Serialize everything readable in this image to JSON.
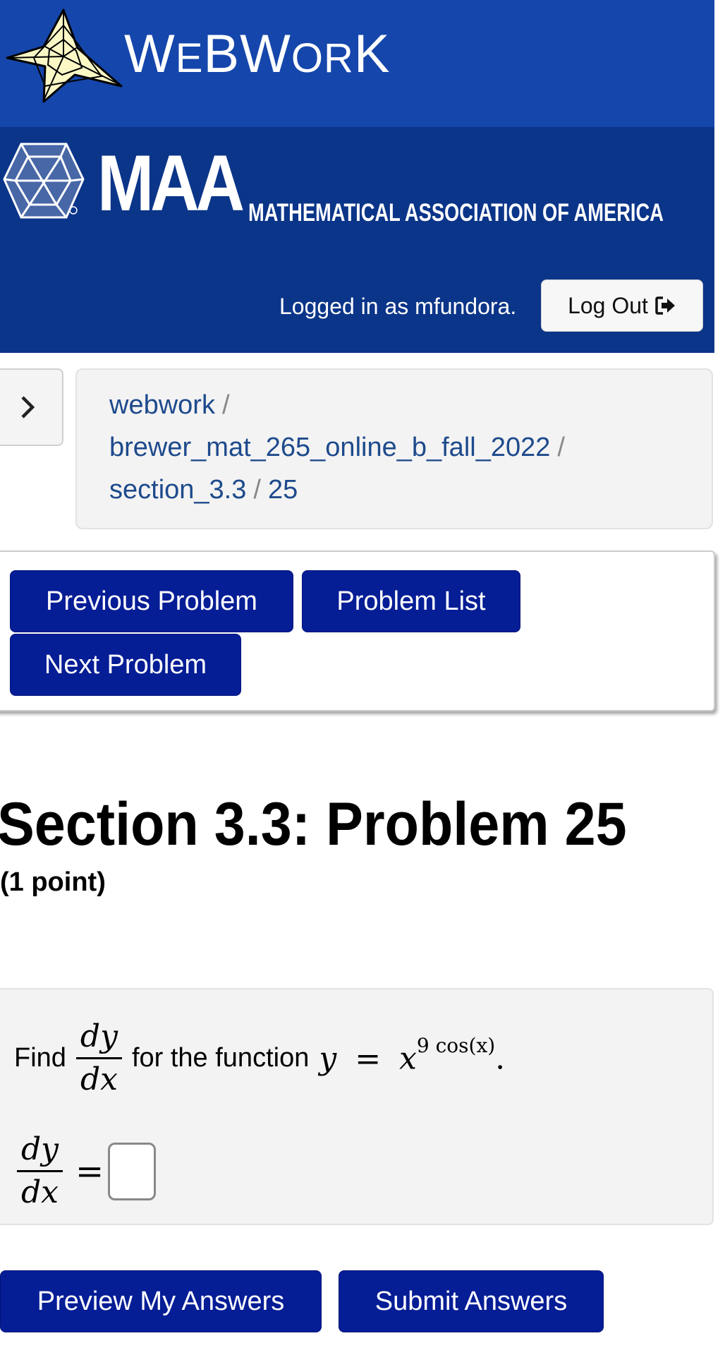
{
  "header": {
    "brand_w": "W",
    "brand_e": "E",
    "brand_bw": "BW",
    "brand_o": "O",
    "brand_r": "R",
    "brand_k": "K",
    "logo_icon": "webwork-spiderweb-star-icon"
  },
  "institution": {
    "abbr": "MAA",
    "full_name": "MATHEMATICAL ASSOCIATION OF AMERICA",
    "logo_icon": "maa-polyhedron-icon"
  },
  "session": {
    "logged_in_text": "Logged in as mfundora.",
    "logout_label": "Log Out",
    "logout_icon": "sign-out-icon"
  },
  "breadcrumb": {
    "items": [
      "webwork",
      "brewer_mat_265_online_b_fall_2022",
      "section_3.3",
      "25"
    ],
    "separator": "/",
    "toggle_icon": "chevron-right-icon"
  },
  "nav": {
    "previous_label": "Previous Problem",
    "list_label": "Problem List",
    "next_label": "Next Problem"
  },
  "problem": {
    "title": "Section 3.3: Problem 25",
    "points": "(1 point)",
    "find_text": "Find",
    "deriv_num": "dy",
    "deriv_den": "dx",
    "mid_text": "for the function",
    "eq_lhs": "y",
    "eq_sign": "=",
    "eq_base": "x",
    "eq_exponent": "9 cos(x)",
    "period": ".",
    "answer_value": ""
  },
  "actions": {
    "preview_label": "Preview My Answers",
    "submit_label": "Submit Answers"
  },
  "colors": {
    "header_blue": "#1546ab",
    "maa_blue": "#0b3589",
    "button_navy": "#051d95",
    "link_blue": "#1d4a8c",
    "panel_gray": "#f3f3f3"
  }
}
